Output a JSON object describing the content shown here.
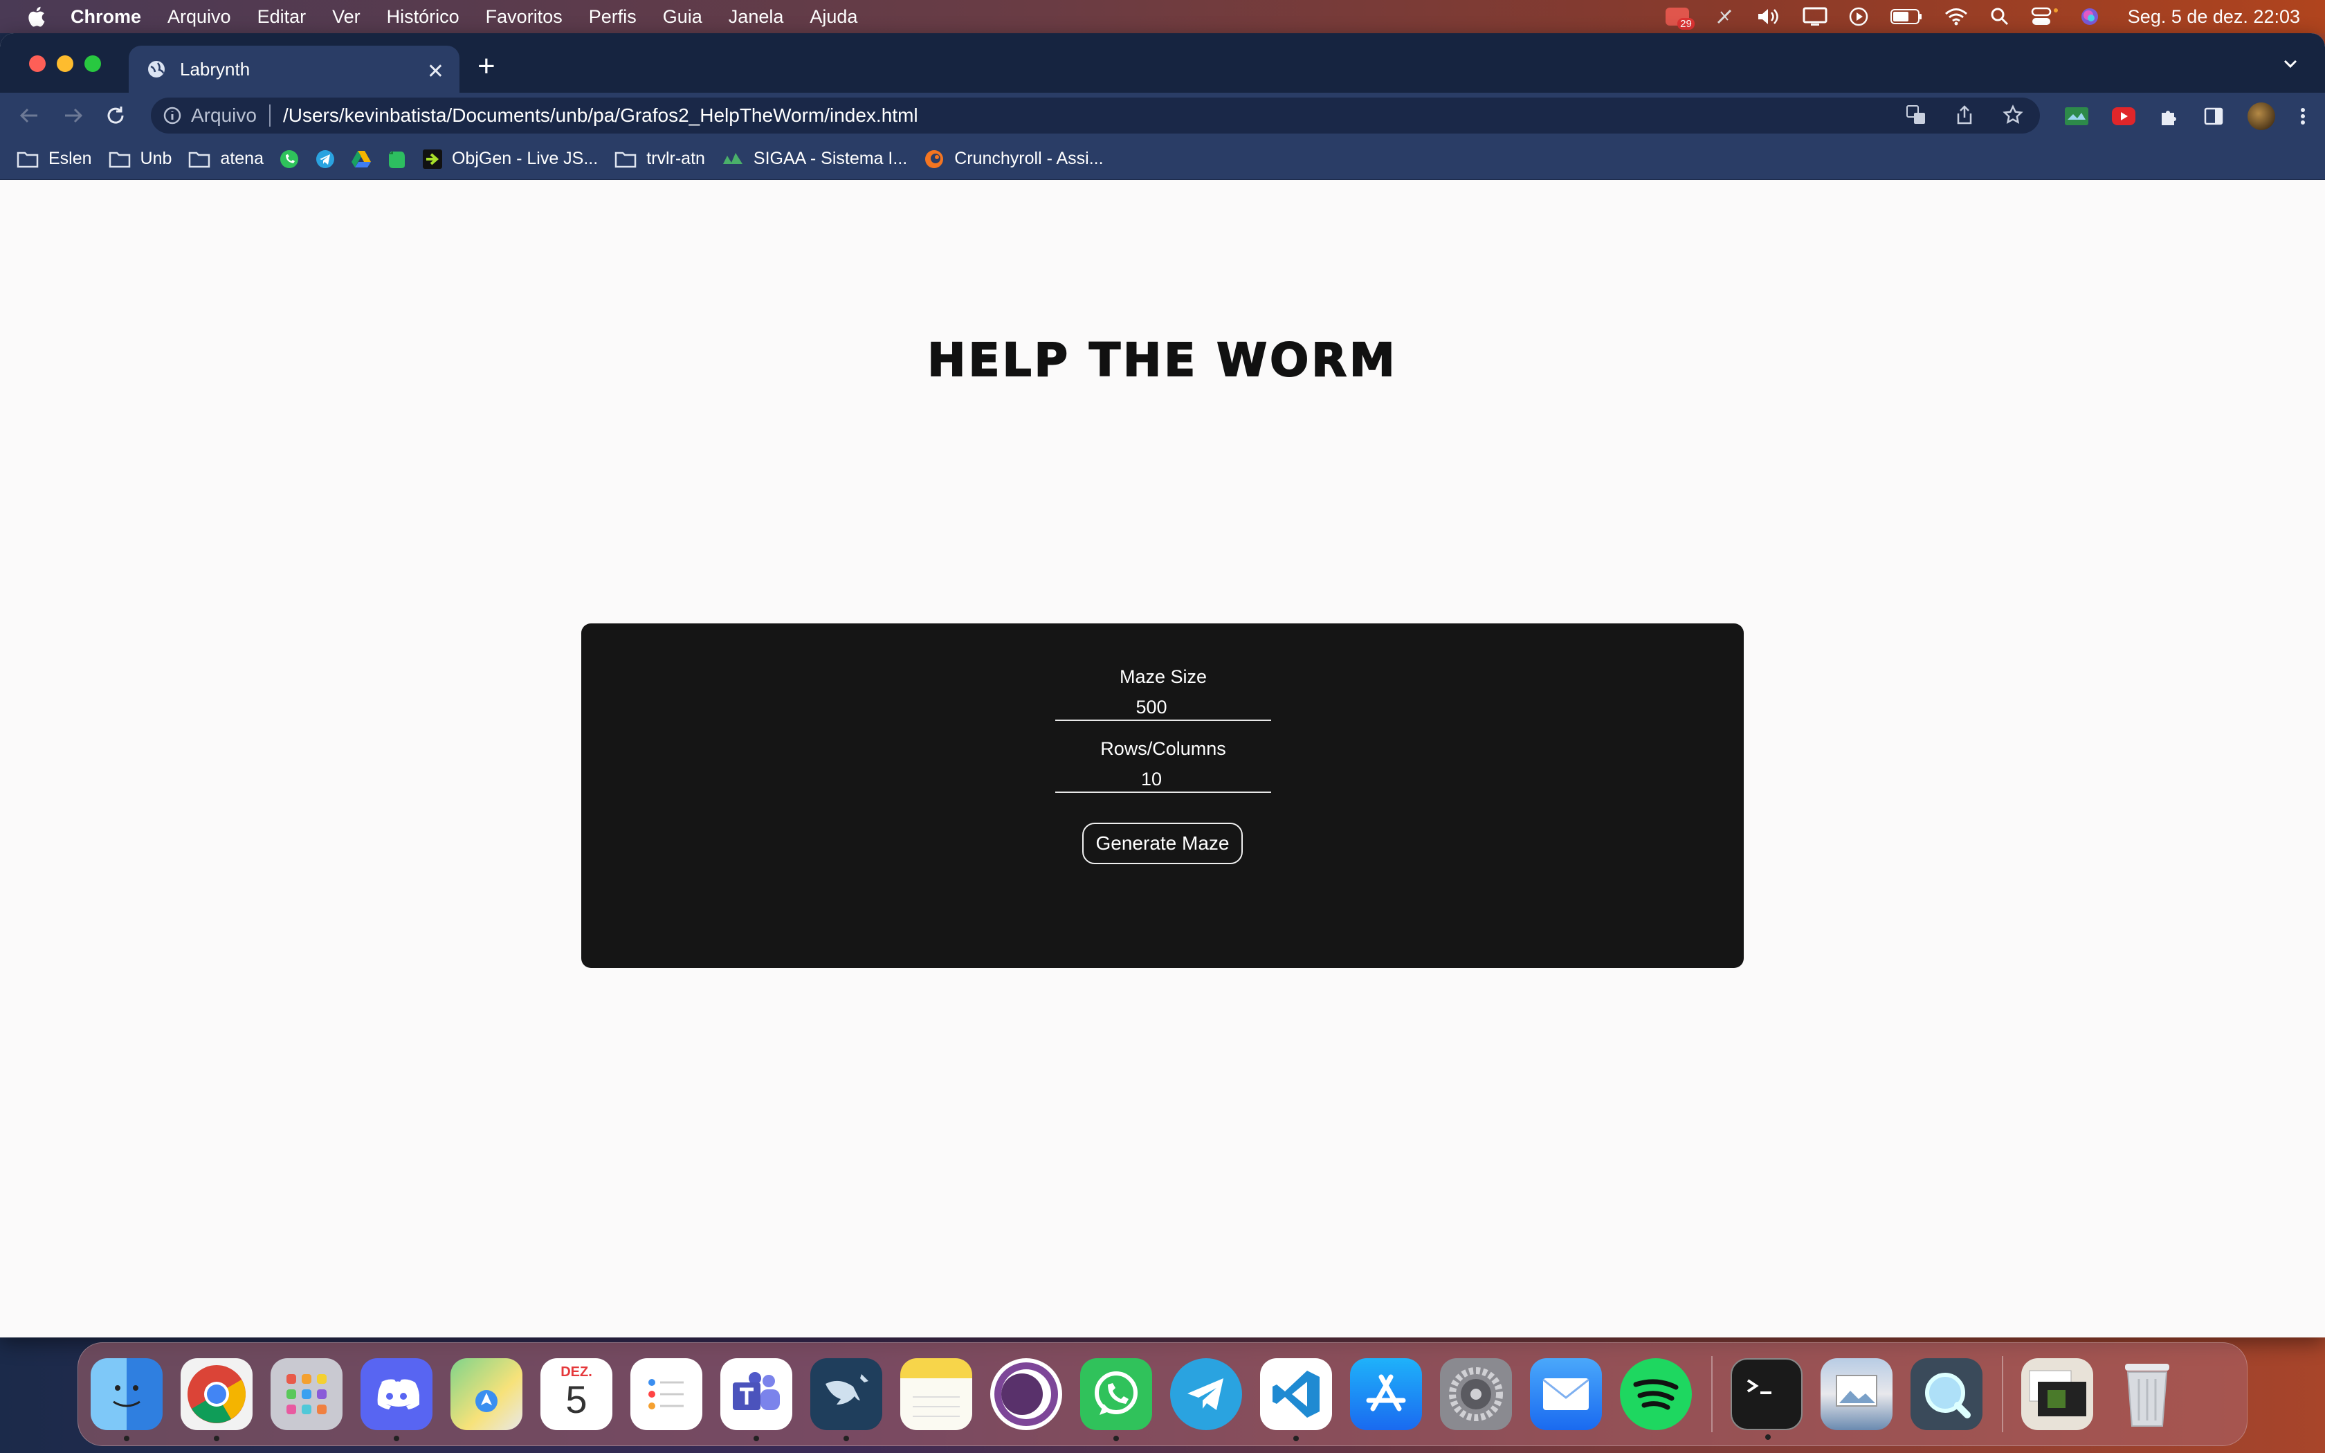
{
  "menubar": {
    "app_name": "Chrome",
    "items": [
      "Arquivo",
      "Editar",
      "Ver",
      "Histórico",
      "Favoritos",
      "Perfis",
      "Guia",
      "Janela",
      "Ajuda"
    ],
    "notification_count": "29",
    "datetime": "Seg. 5 de dez.  22:03"
  },
  "browser": {
    "tab_title": "Labrynth",
    "address_scheme": "Arquivo",
    "address_url": "/Users/kevinbatista/Documents/unb/pa/Grafos2_HelpTheWorm/index.html",
    "bookmarks": [
      {
        "label": "Eslen",
        "icon": "folder-icon"
      },
      {
        "label": "Unb",
        "icon": "folder-icon"
      },
      {
        "label": "atena",
        "icon": "folder-icon"
      },
      {
        "label": "",
        "icon": "whatsapp-icon"
      },
      {
        "label": "",
        "icon": "telegram-icon"
      },
      {
        "label": "",
        "icon": "google-drive-icon"
      },
      {
        "label": "",
        "icon": "evernote-icon"
      },
      {
        "label": "ObjGen - Live JS...",
        "icon": "objgen-icon"
      },
      {
        "label": "trvlr-atn",
        "icon": "folder-icon"
      },
      {
        "label": "SIGAA - Sistema I...",
        "icon": "sigaa-icon"
      },
      {
        "label": "Crunchyroll - Assi...",
        "icon": "crunchyroll-icon"
      }
    ]
  },
  "page": {
    "title": "Help the Worm",
    "maze_size_label": "Maze Size",
    "maze_size_value": "500",
    "rows_columns_label": "Rows/Columns",
    "rows_columns_value": "10",
    "generate_button_label": "Generate Maze"
  },
  "dock": {
    "apps": [
      {
        "name": "finder-icon",
        "color": "#3aa0f0"
      },
      {
        "name": "chrome-icon",
        "color": "#ffffff"
      },
      {
        "name": "launchpad-icon",
        "color": "#c9c9d1"
      },
      {
        "name": "discord-icon",
        "color": "#5865f2"
      },
      {
        "name": "maps-icon",
        "color": "#6fc27a"
      },
      {
        "name": "calendar-icon",
        "color": "#ffffff"
      },
      {
        "name": "reminders-icon",
        "color": "#ffffff"
      },
      {
        "name": "teams-icon",
        "color": "#ffffff"
      },
      {
        "name": "mysql-workbench-icon",
        "color": "#1f3e5c"
      },
      {
        "name": "notes-icon",
        "color": "#f7d54a"
      },
      {
        "name": "tor-browser-icon",
        "color": "#ffffff"
      },
      {
        "name": "whatsapp-icon",
        "color": "#30c25b"
      },
      {
        "name": "telegram-icon",
        "color": "#2aa3e0"
      },
      {
        "name": "vscode-icon",
        "color": "#ffffff"
      },
      {
        "name": "app-store-icon",
        "color": "#1f8bf7"
      },
      {
        "name": "system-preferences-icon",
        "color": "#8a8a90"
      },
      {
        "name": "mail-icon",
        "color": "#3d8cf5"
      },
      {
        "name": "spotify-icon",
        "color": "#1ed760"
      },
      {
        "name": "terminal-icon",
        "color": "#1a1a1a"
      },
      {
        "name": "preview-icon",
        "color": "#d8d8e0"
      },
      {
        "name": "quicktime-icon",
        "color": "#3a4a5a"
      },
      {
        "name": "downloads-stack-icon",
        "color": "#e8e2d8"
      },
      {
        "name": "trash-icon",
        "color": "#d8dbe0"
      }
    ],
    "calendar_month": "DEZ.",
    "calendar_day": "5"
  }
}
